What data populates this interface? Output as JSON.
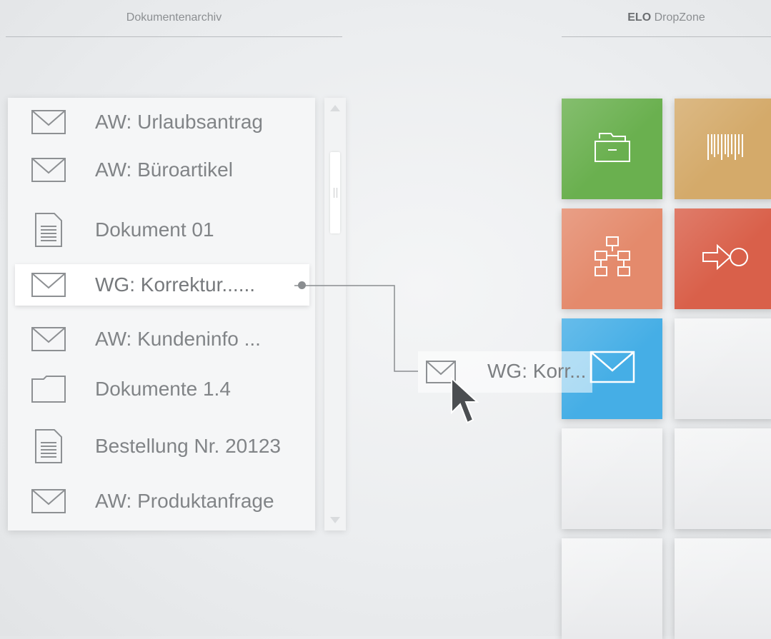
{
  "header": {
    "archive_title": "Dokumentenarchiv",
    "dropzone_brand": "ELO",
    "dropzone_title": "DropZone"
  },
  "document_list": {
    "items": [
      {
        "label": "AW: Urlaubsantrag",
        "icon": "envelope-icon"
      },
      {
        "label": "AW: Büroartikel",
        "icon": "envelope-icon"
      },
      {
        "label": "Dokument 01",
        "icon": "document-icon"
      },
      {
        "label": "WG: Korrektur......",
        "icon": "envelope-icon",
        "selected": true
      },
      {
        "label": "AW: Kundeninfo ...",
        "icon": "envelope-icon"
      },
      {
        "label": "Dokumente 1.4",
        "icon": "folder-icon"
      },
      {
        "label": "Bestellung Nr. 20123",
        "icon": "document-icon"
      },
      {
        "label": "AW: Produktanfrage",
        "icon": "envelope-icon"
      }
    ]
  },
  "drag_ghost": {
    "label": "WG: Korr...",
    "icon": "envelope-icon"
  },
  "dropzone": {
    "tiles": [
      {
        "icon": "folder-drawer-icon",
        "color": "#6ab04f"
      },
      {
        "icon": "barcode-icon",
        "color": "#d4aa6a"
      },
      {
        "icon": "workflow-icon",
        "color": "#e48a6c"
      },
      {
        "icon": "arrow-circle-icon",
        "color": "#d9604a"
      },
      {
        "icon": "envelope-icon",
        "color": "#45aee6"
      },
      {
        "icon": "",
        "color": "#eceeef"
      },
      {
        "icon": "",
        "color": "#eceeef"
      },
      {
        "icon": "",
        "color": "#eceeef"
      },
      {
        "icon": "",
        "color": "#eceeef"
      },
      {
        "icon": "",
        "color": "#eceeef"
      }
    ]
  }
}
